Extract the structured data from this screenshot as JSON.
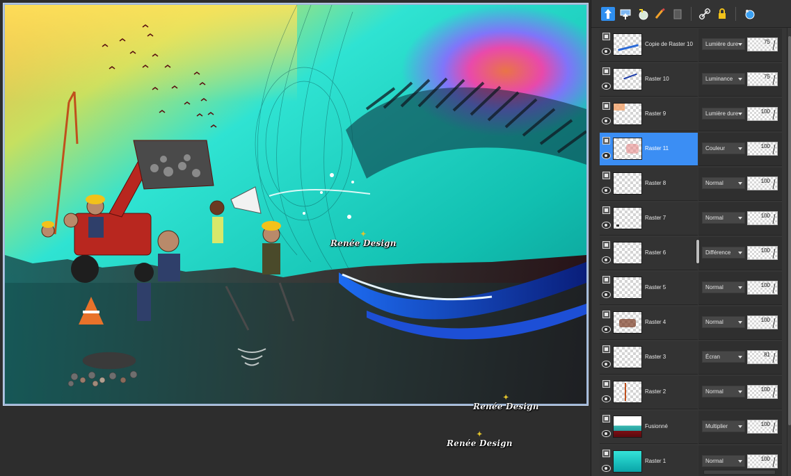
{
  "canvas": {
    "watermark": "Renée Design"
  },
  "toolbar": {
    "icons": [
      "new-raster-layer-icon",
      "new-mask-layer-icon",
      "new-adjustment-layer-icon",
      "brush-icon",
      "delete-layer-icon",
      "link-icon",
      "lock-icon",
      "layer-properties-icon"
    ]
  },
  "colors": {
    "selection": "#3b8ef4",
    "panel_bg": "#363636",
    "canvas_bg": "#2d2d2d"
  },
  "layers": [
    {
      "name": "Copie de Raster 10",
      "blend": "Lumière dure",
      "opacity": "75",
      "thumb": "stroke",
      "selected": false
    },
    {
      "name": "Raster 10",
      "blend": "Luminance",
      "opacity": "75",
      "thumb": "stroke2",
      "selected": false
    },
    {
      "name": "Raster 9",
      "blend": "Lumière dure",
      "opacity": "100",
      "thumb": "orange",
      "selected": false
    },
    {
      "name": "Raster 11",
      "blend": "Couleur",
      "opacity": "100",
      "thumb": "color",
      "selected": true
    },
    {
      "name": "Raster 8",
      "blend": "Normal",
      "opacity": "100",
      "thumb": "empty",
      "selected": false
    },
    {
      "name": "Raster 7",
      "blend": "Normal",
      "opacity": "100",
      "thumb": "dot",
      "selected": false
    },
    {
      "name": "Raster 6",
      "blend": "Différence",
      "opacity": "100",
      "thumb": "empty",
      "selected": false
    },
    {
      "name": "Raster 5",
      "blend": "Normal",
      "opacity": "100",
      "thumb": "empty",
      "selected": false
    },
    {
      "name": "Raster 4",
      "blend": "Normal",
      "opacity": "100",
      "thumb": "figures",
      "selected": false
    },
    {
      "name": "Raster 3",
      "blend": "Écran",
      "opacity": "81",
      "thumb": "empty",
      "selected": false
    },
    {
      "name": "Raster 2",
      "blend": "Normal",
      "opacity": "100",
      "thumb": "crane",
      "selected": false
    },
    {
      "name": "Fusionné",
      "blend": "Multiplier",
      "opacity": "100",
      "thumb": "fusion",
      "selected": false
    },
    {
      "name": "Raster 1",
      "blend": "Normal",
      "opacity": "100",
      "thumb": "raster1",
      "selected": false
    }
  ]
}
